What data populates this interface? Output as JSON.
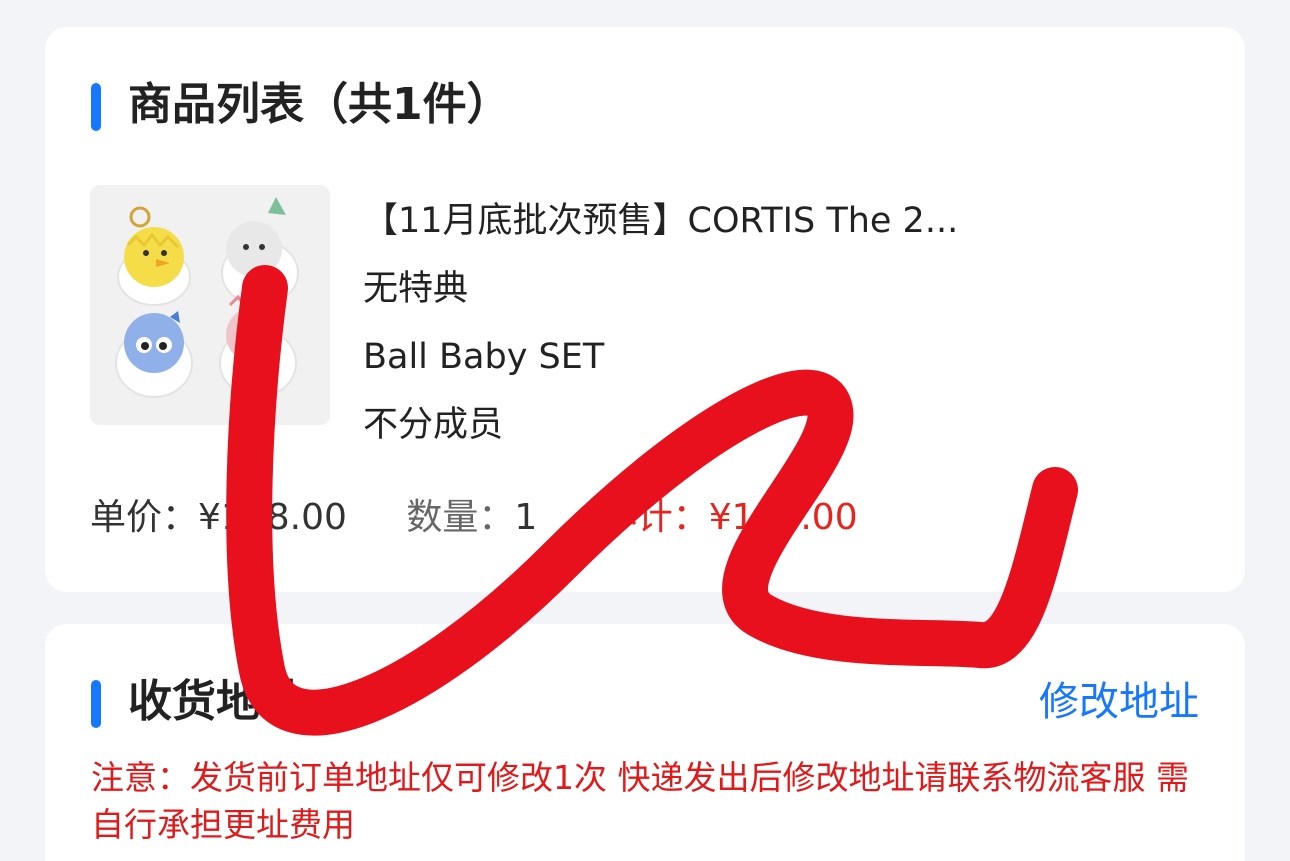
{
  "goods_section": {
    "title": "商品列表（共1件）",
    "product": {
      "title": "【11月底批次预售】CORTIS The 2...",
      "option_1": "无特典",
      "option_2": "Ball Baby SET",
      "option_3": "不分成员"
    },
    "unit_price_label": "单价：",
    "unit_price_value": "¥138.00",
    "quantity_label": "数量：",
    "quantity_value": "1",
    "subtotal_label": "小计：",
    "subtotal_value": "¥138.00"
  },
  "address_section": {
    "title": "收货地址",
    "edit_link": "修改地址",
    "notice": "注意：发货前订单地址仅可修改1次 快递发出后修改地址请联系物流客服 需自行承担更址费用"
  },
  "colors": {
    "accent": "#1677ff",
    "warning": "#e01a1a",
    "scribble": "#e8101c"
  }
}
